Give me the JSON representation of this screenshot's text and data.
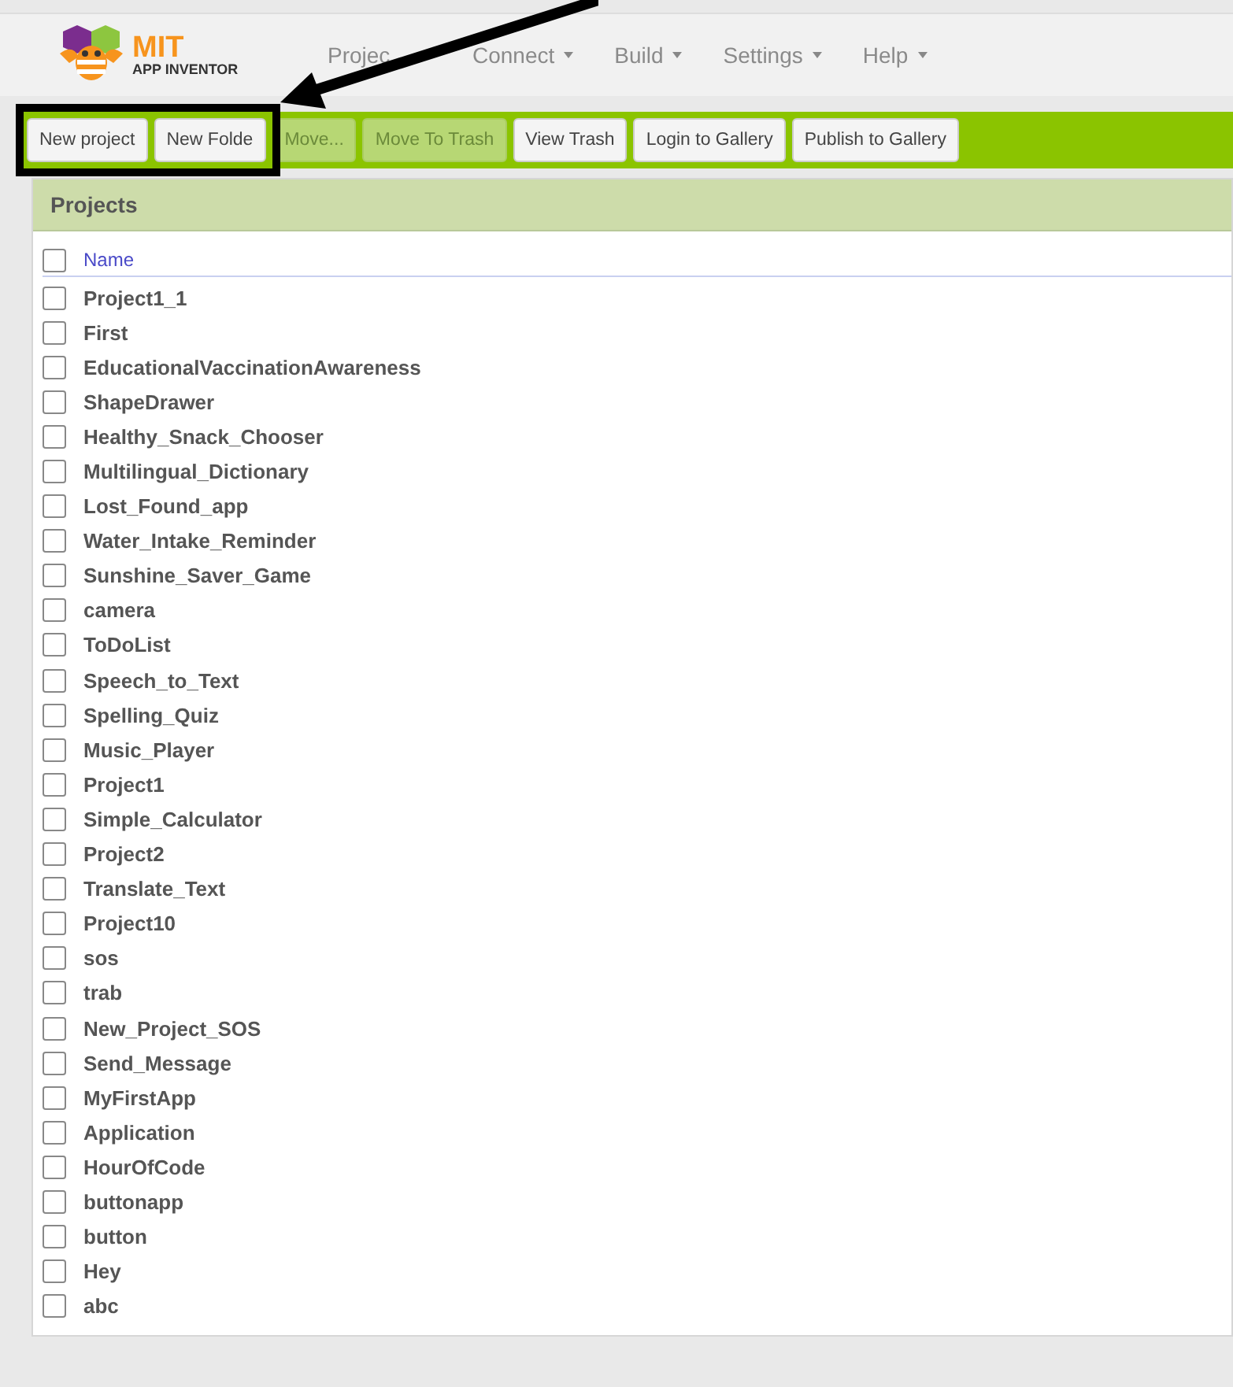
{
  "header": {
    "logo": {
      "title": "MIT",
      "subtitle": "APP INVENTOR"
    },
    "menus": [
      {
        "label": "Projec",
        "caret": false
      },
      {
        "label": "Connect",
        "caret": true
      },
      {
        "label": "Build",
        "caret": true
      },
      {
        "label": "Settings",
        "caret": true
      },
      {
        "label": "Help",
        "caret": true
      }
    ]
  },
  "toolbar": {
    "buttons": [
      {
        "label": "New project",
        "disabled": false
      },
      {
        "label": "New Folde",
        "disabled": false
      },
      {
        "label": "Move...",
        "disabled": true
      },
      {
        "label": "Move To Trash",
        "disabled": true
      },
      {
        "label": "View Trash",
        "disabled": false
      },
      {
        "label": "Login to Gallery",
        "disabled": false
      },
      {
        "label": "Publish to Gallery",
        "disabled": false
      }
    ]
  },
  "projects": {
    "title": "Projects",
    "column": "Name",
    "header_checked": false,
    "rows": [
      {
        "name": "Project1_1",
        "checked": false
      },
      {
        "name": "First",
        "checked": false
      },
      {
        "name": "EducationalVaccinationAwareness",
        "checked": false
      },
      {
        "name": "ShapeDrawer",
        "checked": false
      },
      {
        "name": "Healthy_Snack_Chooser",
        "checked": false
      },
      {
        "name": "Multilingual_Dictionary",
        "checked": false
      },
      {
        "name": "Lost_Found_app",
        "checked": false
      },
      {
        "name": "Water_Intake_Reminder",
        "checked": false
      },
      {
        "name": "Sunshine_Saver_Game",
        "checked": false
      },
      {
        "name": "camera",
        "checked": false
      },
      {
        "name": "ToDoList",
        "checked": false
      },
      {
        "name": "Speech_to_Text",
        "checked": false
      },
      {
        "name": "Spelling_Quiz",
        "checked": false
      },
      {
        "name": "Music_Player",
        "checked": false
      },
      {
        "name": "Project1",
        "checked": false
      },
      {
        "name": "Simple_Calculator",
        "checked": false
      },
      {
        "name": "Project2",
        "checked": false
      },
      {
        "name": "Translate_Text",
        "checked": false
      },
      {
        "name": "Project10",
        "checked": false
      },
      {
        "name": "sos",
        "checked": false
      },
      {
        "name": "trab",
        "checked": false
      },
      {
        "name": "New_Project_SOS",
        "checked": false
      },
      {
        "name": "Send_Message",
        "checked": false
      },
      {
        "name": "MyFirstApp",
        "checked": false
      },
      {
        "name": "Application",
        "checked": false
      },
      {
        "name": "HourOfCode",
        "checked": false
      },
      {
        "name": "buttonapp",
        "checked": false
      },
      {
        "name": "button",
        "checked": false
      },
      {
        "name": "Hey",
        "checked": false
      },
      {
        "name": "abc",
        "checked": false
      }
    ]
  }
}
